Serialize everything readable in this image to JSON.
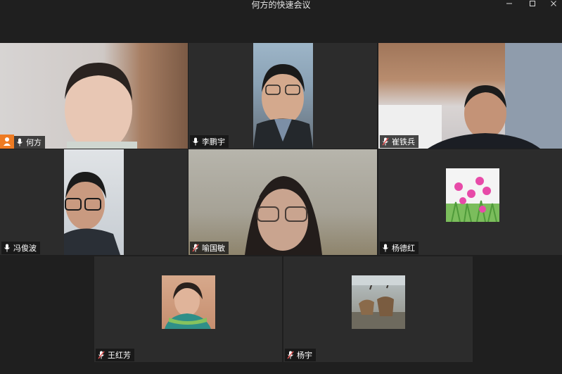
{
  "window": {
    "title": "何方的快速会议",
    "minimize_icon": "minimize-icon",
    "maximize_icon": "maximize-icon",
    "close_icon": "close-icon"
  },
  "participants": [
    {
      "name": "何方",
      "mic": "on",
      "host": true
    },
    {
      "name": "李鹏宇",
      "mic": "on"
    },
    {
      "name": "崔铁兵",
      "mic": "muted"
    },
    {
      "name": "冯俊波",
      "mic": "on"
    },
    {
      "name": "喻国敏",
      "mic": "muted"
    },
    {
      "name": "杨德红",
      "mic": "on"
    },
    {
      "name": "王红芳",
      "mic": "muted"
    },
    {
      "name": "杨宇",
      "mic": "muted"
    }
  ],
  "colors": {
    "background": "#1f1f1f",
    "tile": "#2c2c2c",
    "host_badge": "#ee7b23",
    "muted_mic": "#e05555"
  }
}
